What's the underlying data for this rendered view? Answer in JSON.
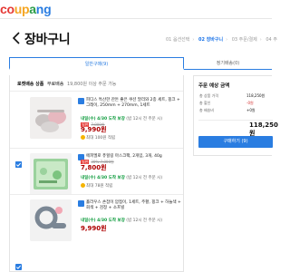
{
  "header": {
    "logo": "coupang",
    "logo_colors": [
      "#e53935",
      "#e53935",
      "#f5a623",
      "#f5a623",
      "#2a9d47",
      "#2a7de1",
      "#2a7de1"
    ]
  },
  "page": {
    "title": "장바구니",
    "steps": [
      {
        "num": "01",
        "label": "옵션선택"
      },
      {
        "num": "02",
        "label": "장바구니",
        "current": true
      },
      {
        "num": "03",
        "label": "주문/결제"
      },
      {
        "num": "04",
        "label": "주"
      }
    ]
  },
  "tabs": [
    {
      "label": "일반구매(9)",
      "active": true
    },
    {
      "label": "정기배송(0)",
      "active": false
    }
  ],
  "rocket": {
    "title": "로켓배송 상품",
    "text": "무료배송",
    "sub": "19,800원 이상 주문 가능"
  },
  "items": [
    {
      "name": "피디스 특산한 잔돈 좋은 쿠션 말리와 2종 세트, 핑크 + 그레이, 250mm + 270mm, 1세트",
      "delivery": "내일(수) 4/30 도착 보장",
      "delivery_sub": "(밤 12시 전 주문 시)",
      "tag": "일반",
      "sale": "7,800원",
      "price": "9,990원",
      "reward": "최대 100원 적립"
    },
    {
      "name": "에피엘로 퓨힐링 마스크팩, 2개입, 3개, 40g",
      "delivery": "내일(수) 4/30 도착 보장",
      "delivery_sub": "(밤 12시 전 주문 시)",
      "tag": "일반",
      "sale": "30% 7,800원",
      "price": "7,800원",
      "reward": "최대 78원 적립"
    },
    {
      "name": "홀라우스 손잡이 압접이, 1세트, 주황, 핑크 + 하늘색 + 회색 + 검정 + 소프빌",
      "delivery": "내일(수) 4/30 도착 보장",
      "delivery_sub": "(밤 12시 전 주문 시)",
      "tag": "일반",
      "sale": "",
      "price": "9,990원",
      "reward": ""
    }
  ],
  "summary": {
    "title": "주문 예상 금액",
    "rows": [
      {
        "label": "총 상품 가격",
        "value": "118,250원"
      },
      {
        "label": "총 할인",
        "value": "-0원"
      },
      {
        "label": "총 배송비",
        "value": "+0원"
      }
    ],
    "total": "118,250원",
    "order_button": "구매하기 (9)"
  }
}
